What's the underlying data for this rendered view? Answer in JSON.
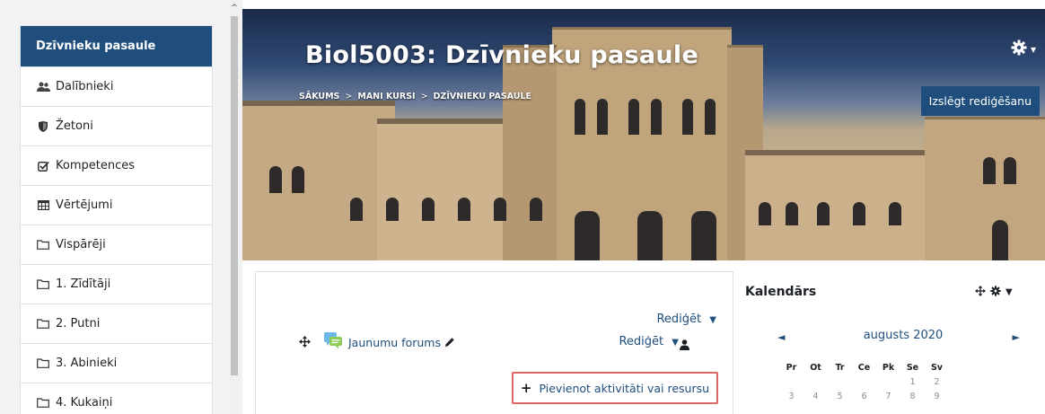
{
  "sidebar": {
    "items": [
      {
        "label": "Dzīvnieku pasaule",
        "icon": "none",
        "active": true
      },
      {
        "label": "Dalībnieki",
        "icon": "users-icon"
      },
      {
        "label": "Žetoni",
        "icon": "shield-icon"
      },
      {
        "label": "Kompetences",
        "icon": "checkbox-icon"
      },
      {
        "label": "Vērtējumi",
        "icon": "table-icon"
      },
      {
        "label": "Vispārēji",
        "icon": "folder-icon"
      },
      {
        "label": "1. Zīdītāji",
        "icon": "folder-icon"
      },
      {
        "label": "2. Putni",
        "icon": "folder-icon"
      },
      {
        "label": "3. Abinieki",
        "icon": "folder-icon"
      },
      {
        "label": "4. Kukaiņi",
        "icon": "folder-icon"
      }
    ]
  },
  "header": {
    "title": "Biol5003: Dzīvnieku pasaule",
    "breadcrumb": [
      "SĀKUMS",
      "MANI KURSI",
      "DZĪVNIEKU PASAULE"
    ],
    "breadcrumb_separator": ">",
    "edit_toggle_label": "Izslēgt rediģēšanu",
    "gear_icon": "gear-icon",
    "accent_color": "#1f4e7c"
  },
  "main": {
    "section_edit_label": "Rediģēt",
    "forum": {
      "name": "Jaunumu forums",
      "edit_label": "Rediģēt"
    },
    "add_activity_label": "Pievienot aktivitāti vai resursu",
    "add_activity_border_color": "#e06666"
  },
  "calendar": {
    "title": "Kalendārs",
    "month": "augusts 2020",
    "weekdays": [
      "Pr",
      "Ot",
      "Tr",
      "Ce",
      "Pk",
      "Se",
      "Sv"
    ],
    "weeks": [
      [
        "",
        "",
        "",
        "",
        "",
        "1",
        "2"
      ],
      [
        "3",
        "4",
        "5",
        "6",
        "7",
        "8",
        "9"
      ]
    ]
  }
}
